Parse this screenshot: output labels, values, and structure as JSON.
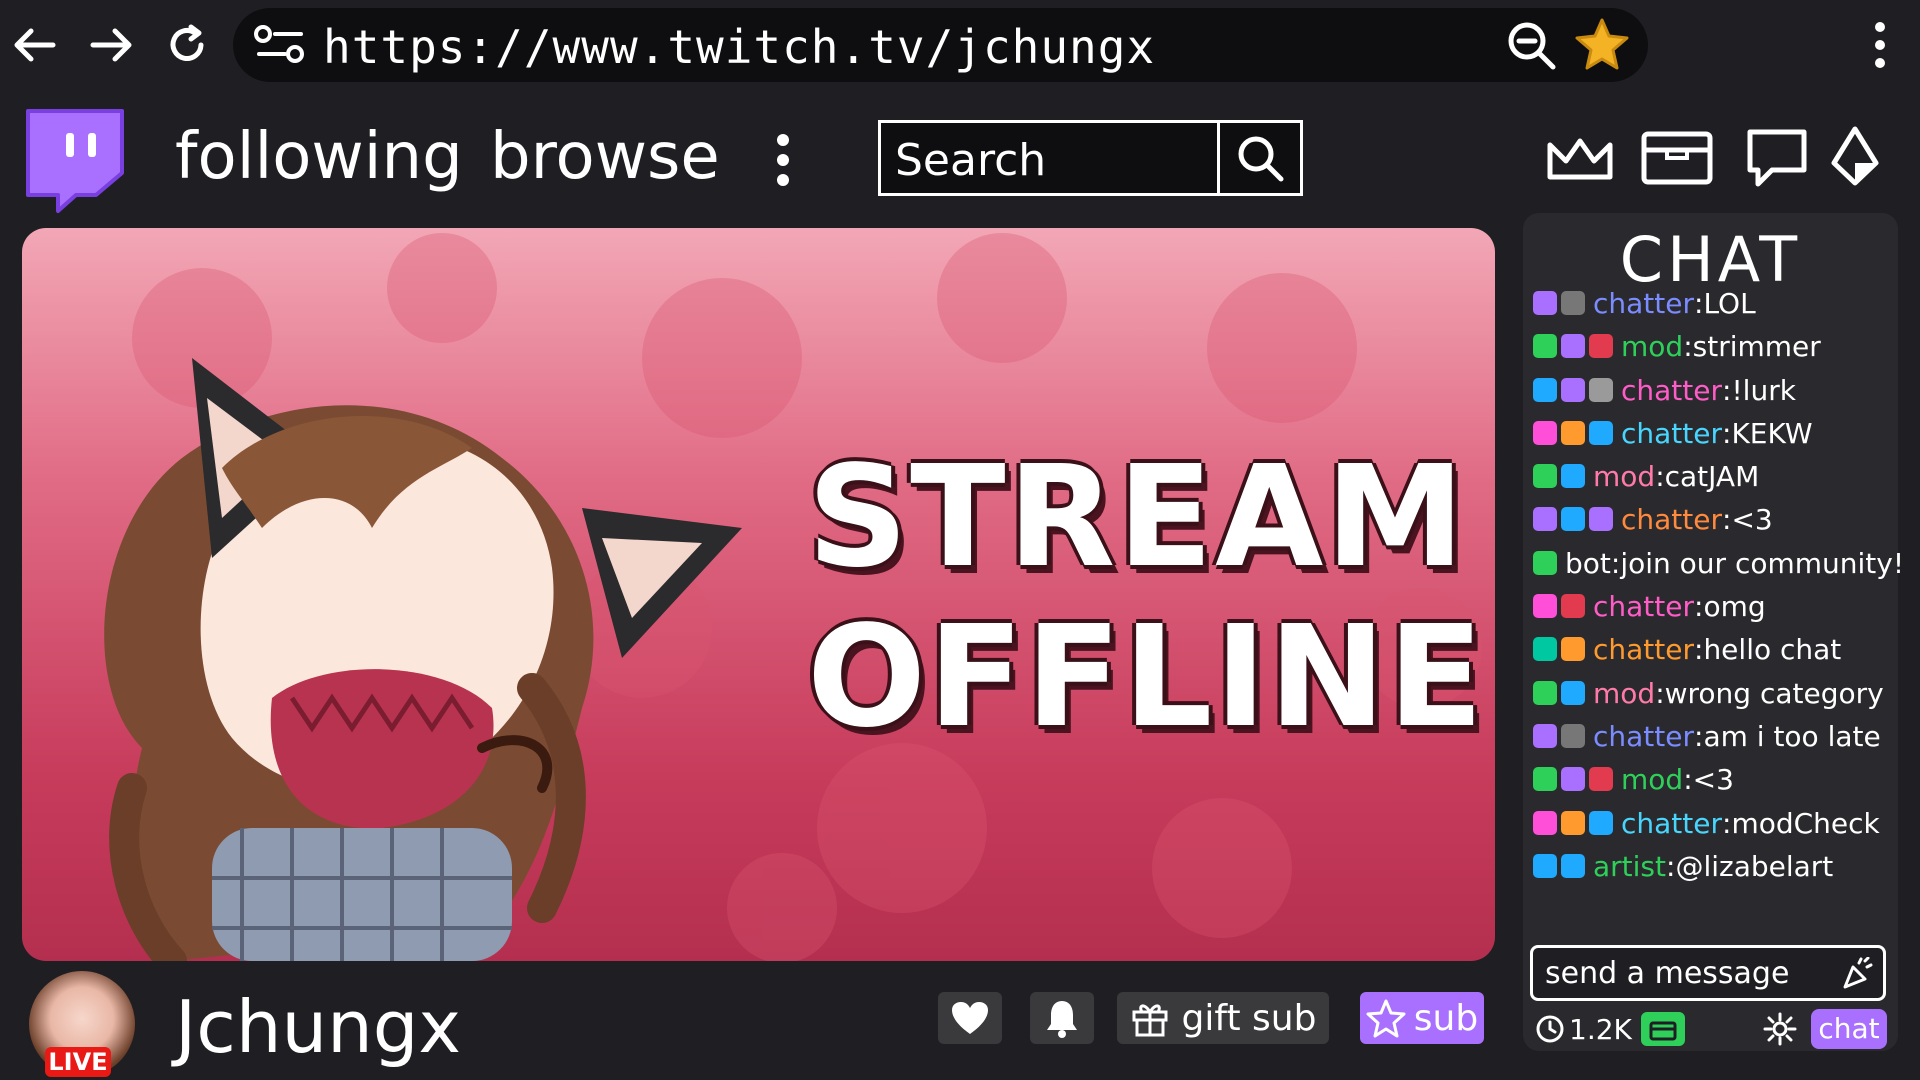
{
  "browser": {
    "url": "https://www.twitch.tv/jchungx"
  },
  "nav": {
    "following": "following",
    "browse": "browse",
    "search_placeholder": "Search"
  },
  "player": {
    "offline_line1": "STREAM",
    "offline_line2": "OFFLINE"
  },
  "chat": {
    "title": "CHAT",
    "messages": [
      {
        "user": "chatter",
        "text": "LOL",
        "color": "#7a8cff",
        "badges": [
          "#a970ff",
          "#777"
        ]
      },
      {
        "user": "mod",
        "text": "strimmer",
        "color": "#2ed05a",
        "badges": [
          "#2ed05a",
          "#a970ff",
          "#e23a4f"
        ]
      },
      {
        "user": "chatter",
        "text": "!lurk",
        "color": "#ff5cc8",
        "badges": [
          "#1fa9ff",
          "#a970ff",
          "#9a9a9a"
        ]
      },
      {
        "user": "chatter",
        "text": "KEKW",
        "color": "#48d6ff",
        "badges": [
          "#ff4fd8",
          "#ff9a2e",
          "#1fa9ff"
        ]
      },
      {
        "user": "mod",
        "text": "catJAM",
        "color": "#ff7aa8",
        "badges": [
          "#2ed05a",
          "#1fa9ff"
        ]
      },
      {
        "user": "chatter",
        "text": "<3",
        "color": "#ff8a3d",
        "badges": [
          "#a970ff",
          "#1fa9ff",
          "#a970ff"
        ]
      },
      {
        "user": "bot",
        "text": "join our community!",
        "color": "#ffffff",
        "badges": [
          "#2ed05a"
        ]
      },
      {
        "user": "chatter",
        "text": "omg",
        "color": "#ff5cc8",
        "badges": [
          "#ff4fd8",
          "#e23a4f"
        ]
      },
      {
        "user": "chatter",
        "text": "hello chat",
        "color": "#ff9a2e",
        "badges": [
          "#00c8a0",
          "#ff9a2e"
        ]
      },
      {
        "user": "mod",
        "text": "wrong category",
        "color": "#ff7aa8",
        "badges": [
          "#2ed05a",
          "#1fa9ff"
        ]
      },
      {
        "user": "chatter",
        "text": "am i too late",
        "color": "#7a8cff",
        "badges": [
          "#a970ff",
          "#777"
        ]
      },
      {
        "user": "mod",
        "text": "<3",
        "color": "#2ed05a",
        "badges": [
          "#2ed05a",
          "#a970ff",
          "#e23a4f"
        ]
      },
      {
        "user": "chatter",
        "text": "modCheck",
        "color": "#48d6ff",
        "badges": [
          "#ff4fd8",
          "#ff9a2e",
          "#1fa9ff"
        ]
      },
      {
        "user": "artist",
        "text": "@lizabelart",
        "color": "#2ed05a",
        "badges": [
          "#1fa9ff",
          "#1fa9ff"
        ]
      }
    ],
    "send_placeholder": "send a message",
    "points": "1.2K",
    "chat_button": "chat"
  },
  "channel": {
    "name": "Jchungx",
    "live_badge": "LIVE",
    "gift_sub": "gift sub",
    "sub": "sub"
  },
  "colors": {
    "twitch_purple": "#9147ff",
    "sub_purple": "#a970ff",
    "live_red": "#e91916"
  }
}
